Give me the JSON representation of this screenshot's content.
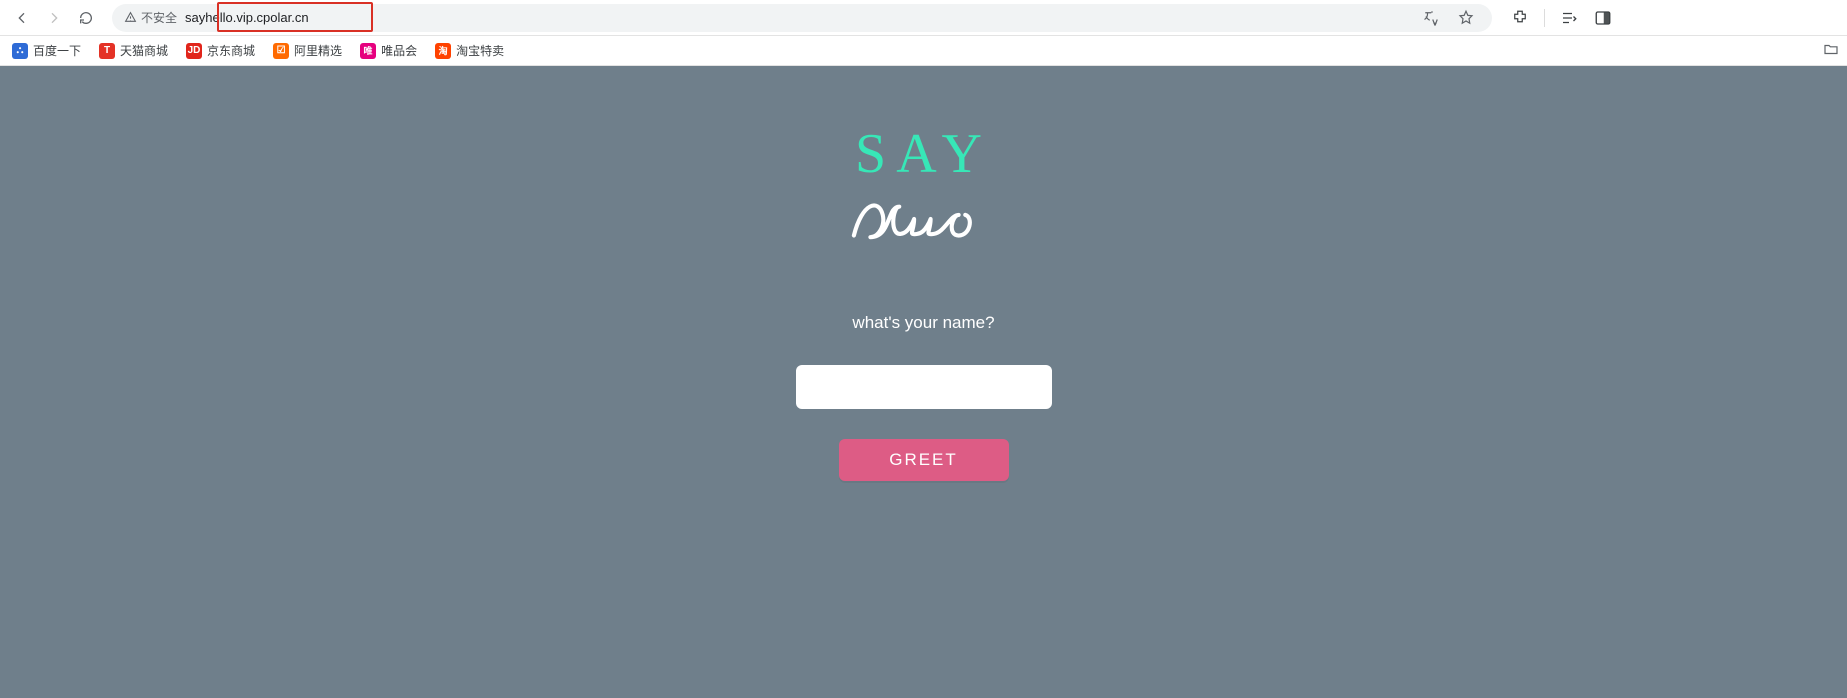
{
  "toolbar": {
    "security_label": "不安全",
    "url": "sayhello.vip.cpolar.cn"
  },
  "bookmarks": [
    {
      "icon_class": "blue",
      "icon_text": "⛬",
      "label": "百度一下"
    },
    {
      "icon_class": "tmall",
      "icon_text": "T",
      "label": "天猫商城"
    },
    {
      "icon_class": "jd",
      "icon_text": "JD",
      "label": "京东商城"
    },
    {
      "icon_class": "ali",
      "icon_text": "☑",
      "label": "阿里精选"
    },
    {
      "icon_class": "vip",
      "icon_text": "唯",
      "label": "唯品会"
    },
    {
      "icon_class": "taobao",
      "icon_text": "淘",
      "label": "淘宝特卖"
    }
  ],
  "page": {
    "title_top": "SAY",
    "title_bottom_alt": "Hello",
    "prompt": "what's your name?",
    "input_value": "",
    "button_label": "GREET"
  },
  "colors": {
    "page_bg": "#6f7f8b",
    "accent_green": "#37e7b7",
    "button_pink": "#dd5c85"
  }
}
